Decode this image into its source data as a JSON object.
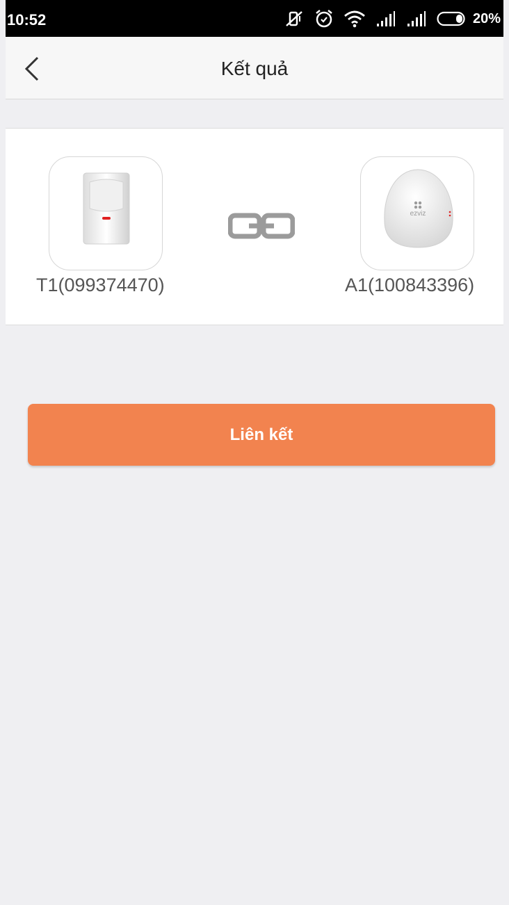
{
  "status_bar": {
    "time": "10:52",
    "battery_percent": "20%",
    "icons": [
      "vibrate-off-icon",
      "alarm-icon",
      "wifi-icon",
      "signal-icon",
      "signal-icon",
      "battery-icon"
    ]
  },
  "header": {
    "title": "Kết quả",
    "back_icon": "chevron-left-icon"
  },
  "devices": {
    "left": {
      "label": "T1(099374470)",
      "icon": "motion-sensor-icon"
    },
    "right": {
      "label": "A1(100843396)",
      "icon": "ezviz-hub-icon",
      "brand_text": "ezviz"
    },
    "link_icon": "link-chain-icon"
  },
  "actions": {
    "link_button_label": "Liên kết"
  },
  "colors": {
    "accent": "#f2834f",
    "background": "#efeff2",
    "card": "#ffffff",
    "link_icon": "#9b9b9b"
  }
}
